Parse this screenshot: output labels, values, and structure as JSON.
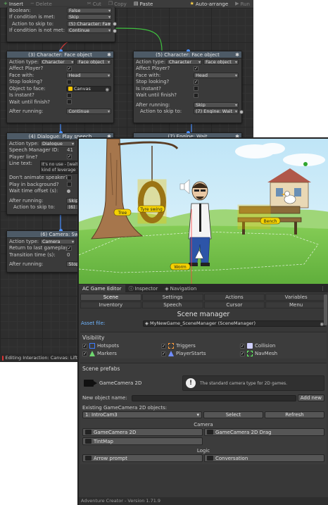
{
  "toolbar": {
    "insert": "Insert",
    "delete": "Delete",
    "cut": "Cut",
    "copy": "Copy",
    "paste": "Paste",
    "auto_arrange": "Auto-arrange",
    "run": "Run"
  },
  "top_node": {
    "rows": [
      {
        "label": "Boolean:",
        "value": "False"
      },
      {
        "label": "If condition is met:",
        "value": "Skip"
      },
      {
        "label": "Action to skip to:",
        "value": "(5) Character: Fac"
      },
      {
        "label": "If condition is not met:",
        "value": "Continue"
      }
    ]
  },
  "node3": {
    "title": "(3) Character: Face object",
    "action_type_label": "Action type:",
    "action_type": "Character",
    "action_sub": "Face object",
    "affect_player": "Affect Player?",
    "face_with_label": "Face with:",
    "face_with": "Head",
    "stop_looking": "Stop looking?",
    "object_label": "Object to face:",
    "object": "Canvas",
    "is_instant": "Is instant?",
    "wait_finish": "Wait until finish?",
    "after_running_label": "After running:",
    "after_running": "Continue"
  },
  "node5": {
    "title": "(5) Character: Face object",
    "action_type_label": "Action type:",
    "action_type": "Character",
    "action_sub": "Face object",
    "affect_player": "Affect Player?",
    "face_with_label": "Face with:",
    "face_with": "Head",
    "stop_looking": "Stop looking?",
    "is_instant": "Is instant?",
    "wait_finish": "Wait until finish?",
    "after_running_label": "After running:",
    "after_running": "Skip",
    "skip_label": "Action to skip to:",
    "skip_to": "(7) Engine: Wait"
  },
  "node4": {
    "title": "(4) Dialogue: Play speech",
    "action_type_label": "Action type:",
    "action_type": "Dialogue",
    "speech_id_label": "Speech Manager ID:",
    "speech_id": "41",
    "player_line": "Player line?",
    "line_text_label": "Line text:",
    "line_text_1": "It's no use - [wait:0.",
    "line_text_2": "kind of leverage to",
    "dont_animate": "Don't animate speaker?",
    "play_bg": "Play in background?",
    "wait_offset": "Wait time offset (s):",
    "after_running_label": "After running:",
    "after_running": "Skip",
    "skip_label": "Action to skip to:",
    "skip_to": "(6)"
  },
  "node7": {
    "title": "(7) Engine: Wait"
  },
  "node6": {
    "title": "(6) Camera: Swi",
    "action_type_label": "Action type:",
    "action_type": "Camera",
    "return_label": "Return to last gameplay?",
    "transition_label": "Transition time (s):",
    "transition": "0",
    "after_running_label": "After running:",
    "after_running": "Stop"
  },
  "status_bar": {
    "text": "Editing Interaction: Canvas: Lift"
  },
  "scene": {
    "labels": {
      "tree": "Tree",
      "tyre_swing": "Tyre swing",
      "bench": "Bench",
      "worm": "Worm"
    },
    "colors": {
      "sky": "#c9eaf7",
      "grass": "#76c24a",
      "trunk": "#a0704a",
      "hotspot": "#f5c400"
    }
  },
  "panel": {
    "tabs": [
      {
        "label": "AC Game Editor",
        "icon": "ac-icon"
      },
      {
        "label": "Inspector",
        "icon": "info-icon"
      },
      {
        "label": "Navigation",
        "icon": "nav-icon"
      }
    ],
    "categories": [
      "Scene",
      "Settings",
      "Actions",
      "Variables",
      "Inventory",
      "Speech",
      "Cursor",
      "Menu"
    ],
    "title": "Scene manager",
    "asset_file_label": "Asset file:",
    "asset_file": "MyNewGame_SceneManager (SceneManager)",
    "visibility": {
      "title": "Visibility",
      "items": [
        {
          "label": "Hotspots",
          "color": "#3d7cff"
        },
        {
          "label": "Triggers",
          "color": "#ff9c3a"
        },
        {
          "label": "Collision",
          "color": "#d0d0ff"
        },
        {
          "label": "Markers",
          "color": "#6fd66f"
        },
        {
          "label": "PlayerStarts",
          "color": "#6f8cff"
        },
        {
          "label": "NavMesh",
          "color": "#66ff66"
        }
      ]
    },
    "prefabs": {
      "title": "Scene prefabs",
      "camera_name": "GameCamera 2D",
      "info": "The standard camera type for 2D games.",
      "new_object_label": "New object name:",
      "add_new": "Add new",
      "existing_label": "Existing GameCamera 2D objects:",
      "existing_value": "1: IntroCam3",
      "select": "Select",
      "refresh": "Refresh"
    },
    "camera_group": {
      "title": "Camera",
      "buttons": [
        "GameCamera 2D",
        "GameCamera 2D Drag",
        "TintMap"
      ]
    },
    "logic_group": {
      "title": "Logic",
      "buttons": [
        "Arrow prompt",
        "Conversation"
      ]
    },
    "footer": "Adventure Creator - Version 1.71.9"
  }
}
